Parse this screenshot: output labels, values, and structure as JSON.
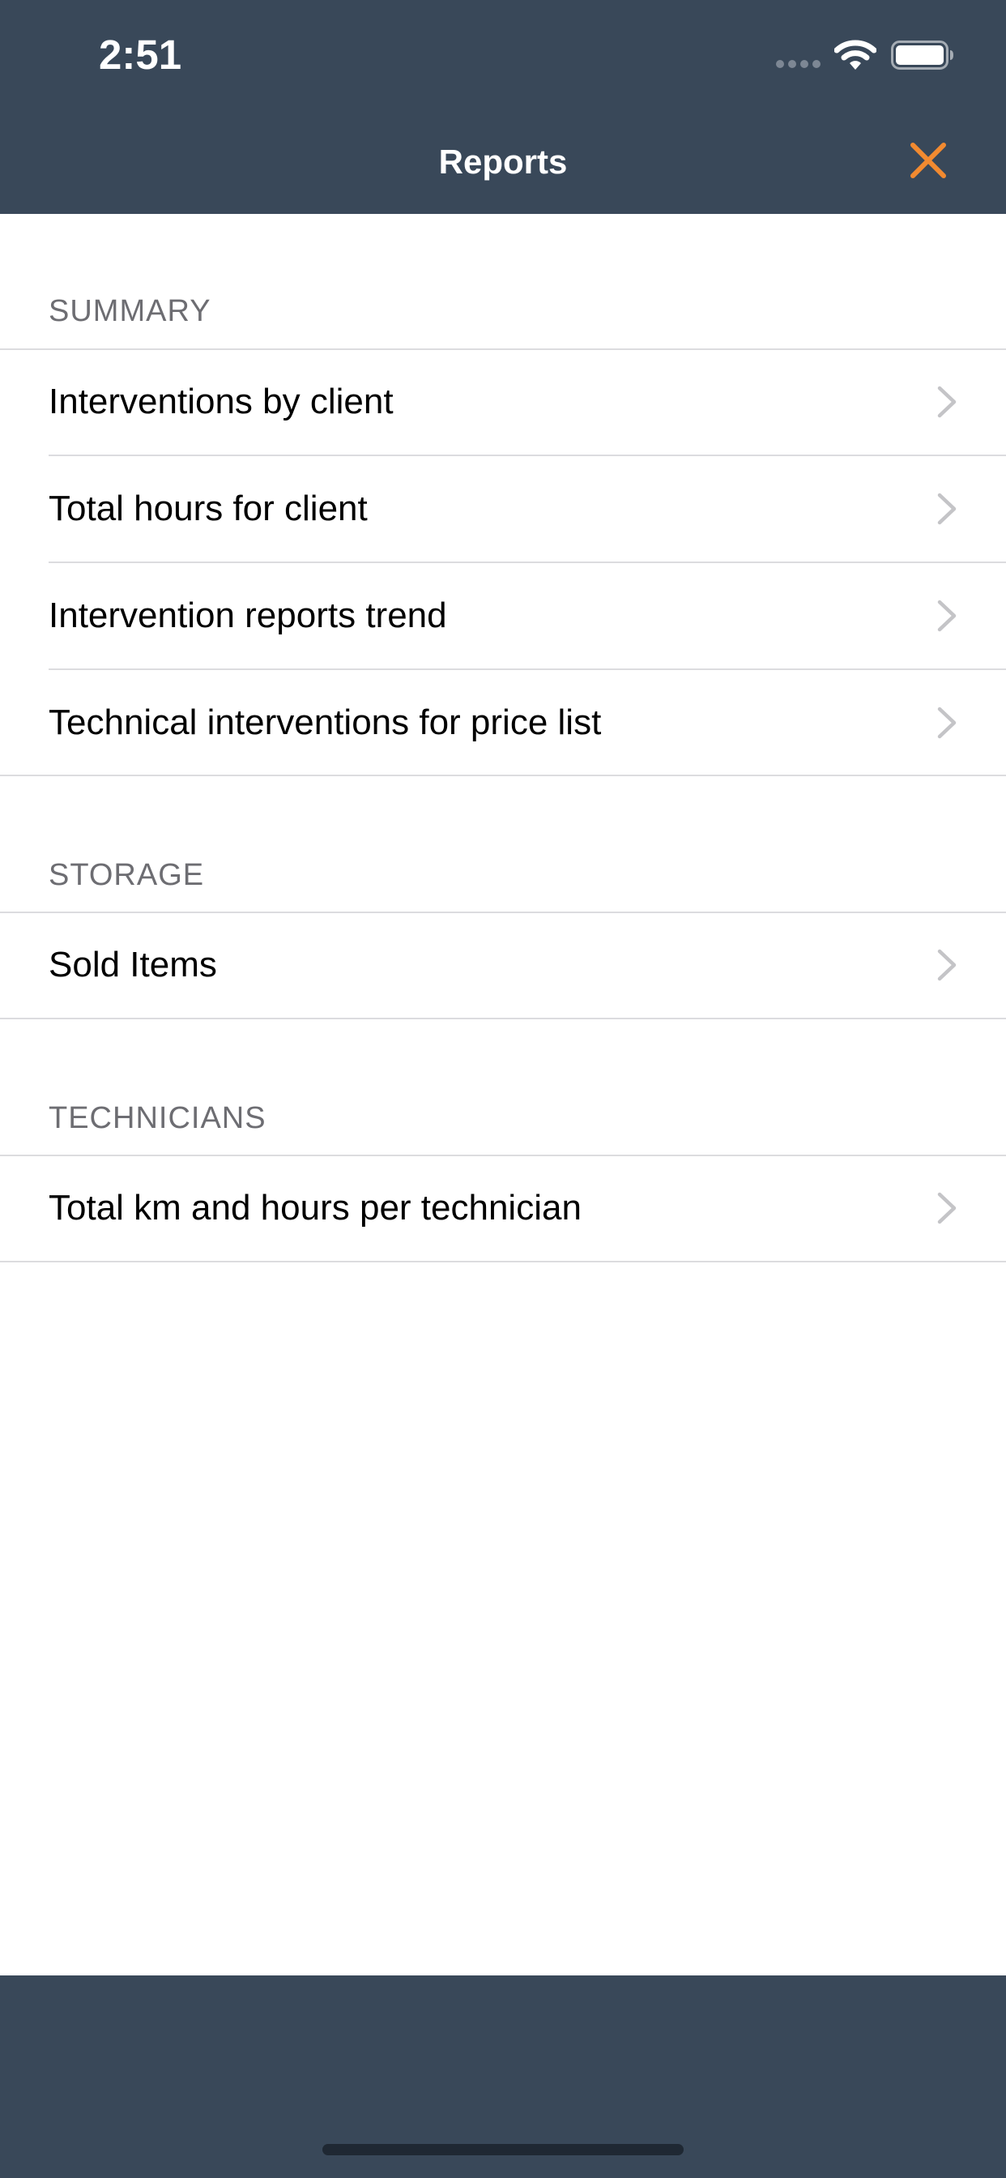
{
  "status_bar": {
    "time": "2:51"
  },
  "nav": {
    "title": "Reports",
    "close_icon": "close-icon",
    "accent_color": "#F28A30",
    "bar_color": "#394859"
  },
  "sections": [
    {
      "header": "SUMMARY",
      "items": [
        "Interventions by client",
        "Total hours for client",
        "Intervention reports trend",
        "Technical interventions for price list"
      ]
    },
    {
      "header": "STORAGE",
      "items": [
        "Sold Items"
      ]
    },
    {
      "header": "TECHNICIANS",
      "items": [
        "Total km and hours per technician"
      ]
    }
  ]
}
